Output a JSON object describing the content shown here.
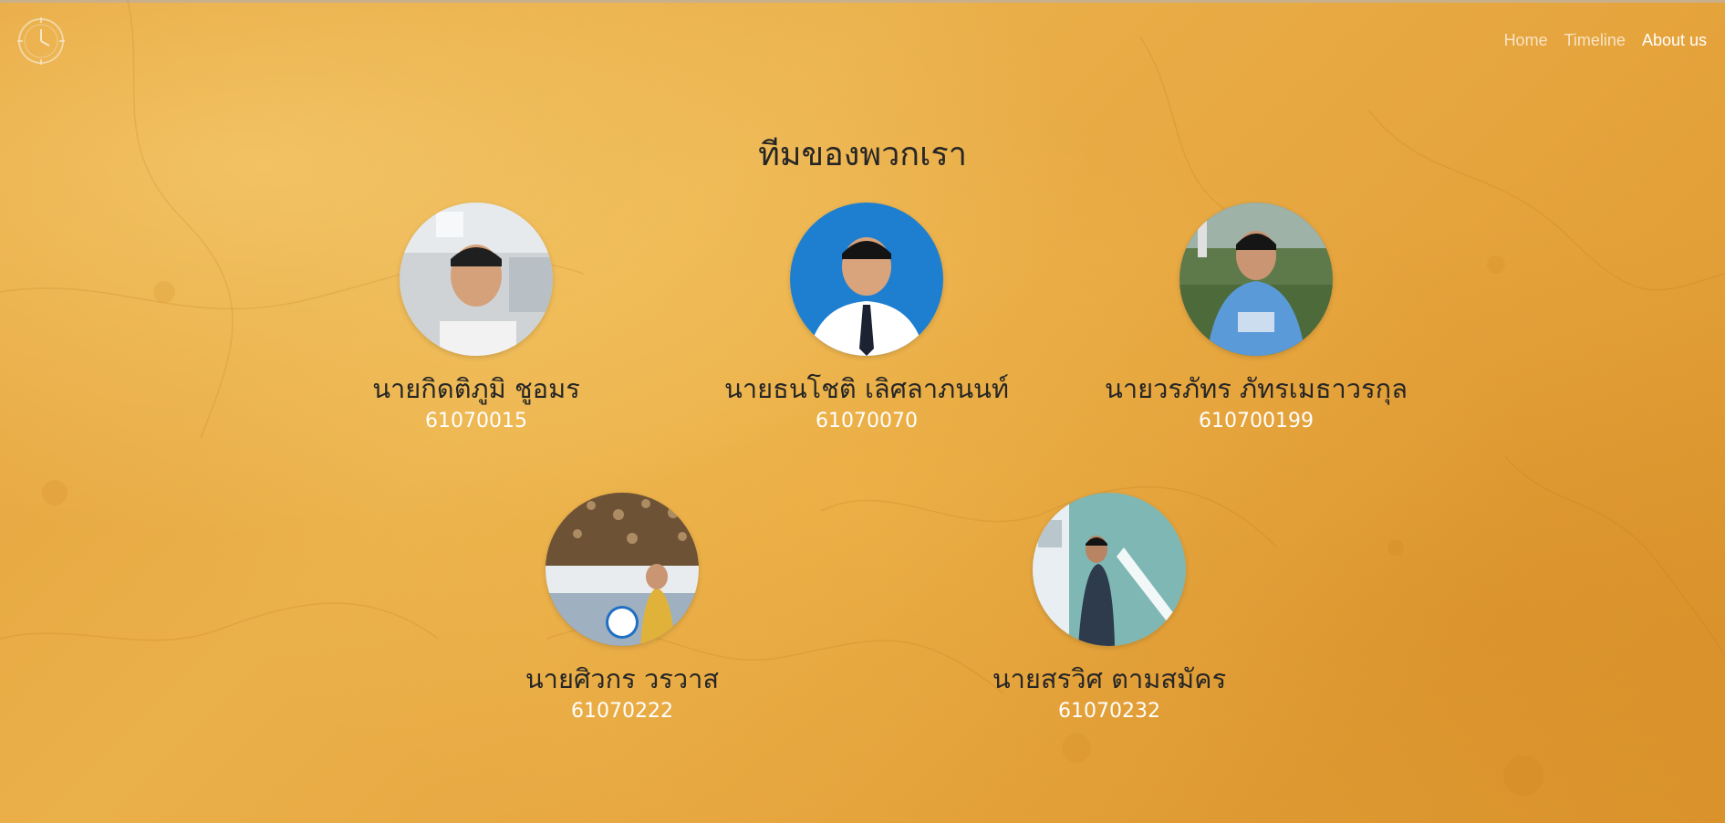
{
  "nav": {
    "items": [
      {
        "label": "Home"
      },
      {
        "label": "Timeline"
      },
      {
        "label": "About us"
      }
    ],
    "active": "About us"
  },
  "logo": {
    "icon": "clock-logo-icon"
  },
  "page_title": "ทีมของพวกเรา",
  "members": [
    {
      "name": "นายกิดติภูมิ ชูอมร",
      "student_id": "61070015"
    },
    {
      "name": "นายธนโชติ เลิศลาภนนท์",
      "student_id": "61070070"
    },
    {
      "name": "นายวรภัทร ภัทรเมธาวรกุล",
      "student_id": "610700199"
    },
    {
      "name": "นายศิวกร วรวาส",
      "student_id": "61070222"
    },
    {
      "name": "นายสรวิศ ตามสมัคร",
      "student_id": "61070232"
    }
  ],
  "colors": {
    "background": "#e6a43d",
    "title_text": "#262626",
    "id_text": "#ffffff",
    "nav_active": "#ffffff"
  }
}
